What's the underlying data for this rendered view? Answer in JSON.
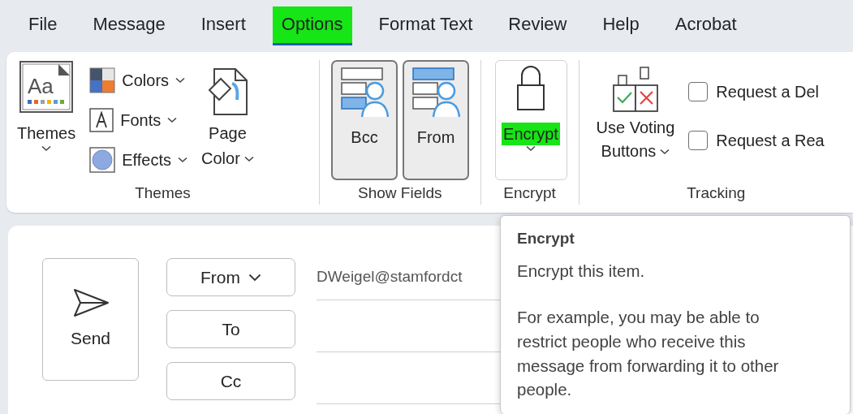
{
  "menu_tabs": [
    {
      "label": "File",
      "selected": false,
      "highlighted": false
    },
    {
      "label": "Message",
      "selected": false,
      "highlighted": false
    },
    {
      "label": "Insert",
      "selected": false,
      "highlighted": false
    },
    {
      "label": "Options",
      "selected": true,
      "highlighted": true
    },
    {
      "label": "Format Text",
      "selected": false,
      "highlighted": false
    },
    {
      "label": "Review",
      "selected": false,
      "highlighted": false
    },
    {
      "label": "Help",
      "selected": false,
      "highlighted": false
    },
    {
      "label": "Acrobat",
      "selected": false,
      "highlighted": false
    }
  ],
  "themes_group": {
    "label": "Themes",
    "icon_text": "Aa",
    "themes_button": "Themes",
    "items": [
      "Colors",
      "Fonts",
      "Effects"
    ],
    "page_color": [
      "Page",
      "Color"
    ]
  },
  "show_fields_group": {
    "label": "Show Fields",
    "buttons": [
      {
        "label": "Bcc",
        "pressed": true
      },
      {
        "label": "From",
        "pressed": true
      }
    ]
  },
  "encrypt_group": {
    "label": "Encrypt",
    "button": {
      "label": "Encrypt",
      "highlighted": true
    }
  },
  "tracking_group": {
    "label": "Tracking",
    "voting_button": [
      "Use Voting",
      "Buttons"
    ],
    "checkboxes": [
      {
        "label": "Request a Del",
        "checked": false
      },
      {
        "label": "Request a Rea",
        "checked": false
      }
    ]
  },
  "compose": {
    "send_button": "Send",
    "field_buttons": [
      {
        "label": "From",
        "dropdown": true
      },
      {
        "label": "To",
        "dropdown": false
      },
      {
        "label": "Cc",
        "dropdown": false
      }
    ],
    "from_value": "DWeigel@stamfordct"
  },
  "tooltip": {
    "title": "Encrypt",
    "paragraphs": [
      "Encrypt this item.",
      "For example, you may be able to restrict people who receive this message from forwarding it to other people."
    ]
  }
}
